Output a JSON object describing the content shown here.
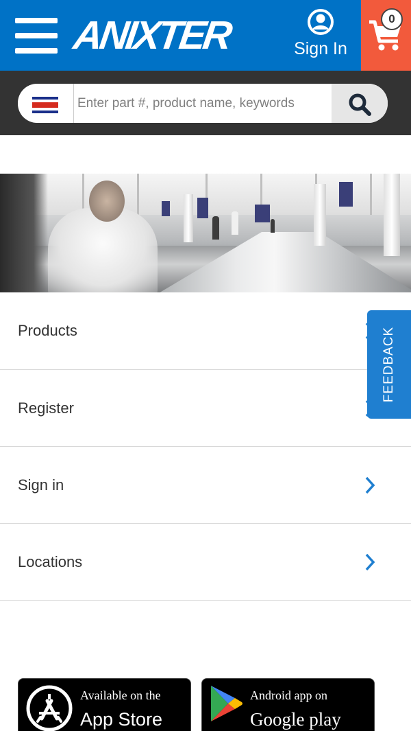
{
  "header": {
    "logo_text": "ANIXTER",
    "signin_label": "Sign In",
    "cart_count": "0",
    "colors": {
      "header_bg": "#0072c6",
      "cart_bg": "#f25a3c"
    },
    "icons": {
      "menu": "hamburger-menu-icon",
      "user": "user-circle-icon",
      "cart": "shopping-cart-icon"
    }
  },
  "search": {
    "placeholder": "Enter part #, product name, keywords",
    "value": "",
    "country_flag": "costa-rica-flag-icon",
    "icon": "search-icon"
  },
  "hero": {
    "image": "airport-moving-walkway-photo"
  },
  "menu": {
    "items": [
      {
        "label": "Products"
      },
      {
        "label": "Register"
      },
      {
        "label": "Sign in"
      },
      {
        "label": "Locations"
      }
    ],
    "chevron_color": "#1f7fd0"
  },
  "feedback": {
    "label": "FEEDBACK"
  },
  "app_badges": {
    "appstore": {
      "line1": "Available on the",
      "line2": "App Store",
      "icon": "app-store-icon"
    },
    "gplay": {
      "line1": "Android app on",
      "line2": "Google play",
      "icon": "google-play-icon"
    }
  }
}
